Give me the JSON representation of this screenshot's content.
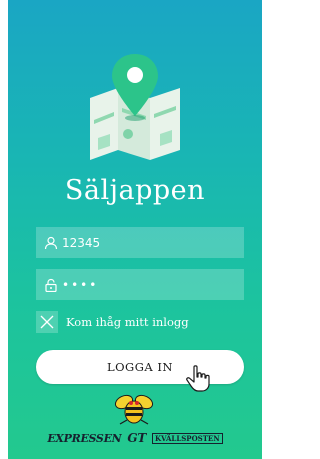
{
  "app": {
    "title": "Säljappen"
  },
  "login_form": {
    "username_value": "12345",
    "password_value": "••••",
    "remember_label": "Kom ihåg mitt inlogg",
    "remember_checked": false,
    "submit_label": "LOGGA IN"
  },
  "branding": {
    "brand_1": "EXPRESSEN",
    "brand_2": "GT",
    "brand_3": "KVÄLLSPOSTEN"
  },
  "icons": {
    "map": "map-with-location-pin",
    "user": "user-icon",
    "lock": "lock-icon",
    "checkbox": "x-mark-icon",
    "cursor": "hand-pointer-icon",
    "mascot": "wasp-mascot-icon"
  },
  "colors": {
    "gradient_top": "#1aa6c4",
    "gradient_bottom": "#23c98e",
    "pin": "#2cc48a",
    "button_bg": "#ffffff",
    "brand_text": "#16212e"
  }
}
